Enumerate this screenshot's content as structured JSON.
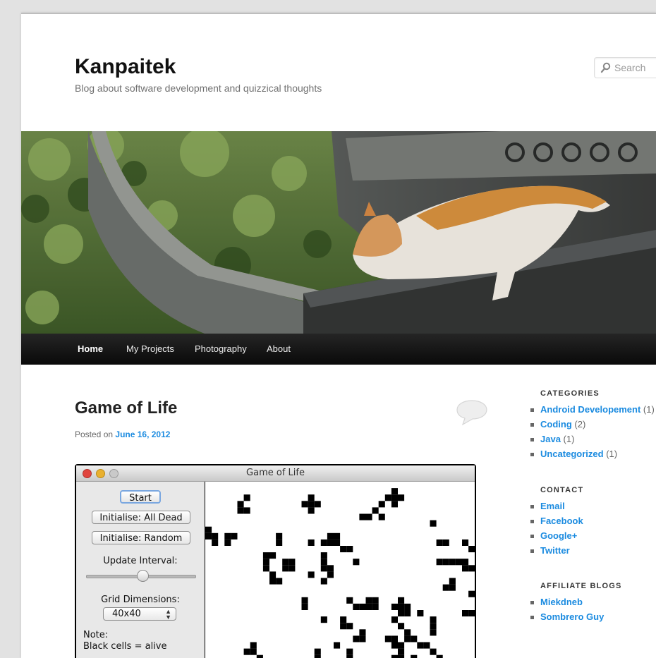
{
  "site": {
    "title": "Kanpaitek",
    "description": "Blog about software development and quizzical thoughts"
  },
  "search": {
    "placeholder": "Search",
    "icon": "search-icon"
  },
  "nav": {
    "items": [
      "Home",
      "My Projects",
      "Photography",
      "About"
    ],
    "current": "Home"
  },
  "post": {
    "title": "Game of Life",
    "posted_prefix": "Posted on",
    "date": "June 16, 2012",
    "comment_icon": "comment-bubble-icon"
  },
  "app_window": {
    "title": "Game of Life",
    "buttons": {
      "start": "Start",
      "init_dead": "Initialise: All Dead",
      "init_random": "Initialise: Random"
    },
    "update_interval_label": "Update Interval:",
    "update_interval_value": 0.52,
    "grid_dimensions_label": "Grid Dimensions:",
    "grid_dimensions_value": "40x40",
    "note_title": "Note:",
    "note_line1": "Black cells = alive",
    "grid_rows": [
      "..........................................",
      ".............................#............",
      "......#.........#...........###...........",
      ".....#.........###.........#.#............",
      ".....##.........#.........#...............",
      "........................##.#..............",
      "...................................#......",
      "#.........................................",
      "##.##......#.......##.....................",
      ".#.#.......#....#.###...............##..#..",
      ".....................##..................#.",
      ".........##.......#.......................",
      ".........#..##....#....#............#####.",
      ".........#..##....##....................##",
      "..........#.....#..#......................",
      "..........##......#...................#...",
      ".....................................##...",
      ".........................................#",
      "...............#......#..##...#...........",
      "...............#.......####..###..........",
      "..............................##.#......##",
      "..................#..#.......#.....#......",
      ".....................##.......#....#......",
      "........................#......#...#......",
      ".......................##...##.##.........",
      ".......#............#........##..##.......",
      "......##.........#....#.......#....#......",
      "........#........#....#......##.#...#.....",
      "..........#....##.....#...........#......."
    ]
  },
  "sidebar": {
    "categories": {
      "title": "CATEGORIES",
      "items": [
        {
          "label": "Android Developement",
          "count": "(1)"
        },
        {
          "label": "Coding",
          "count": "(2)"
        },
        {
          "label": "Java",
          "count": "(1)"
        },
        {
          "label": "Uncategorized",
          "count": "(1)"
        }
      ]
    },
    "contact": {
      "title": "CONTACT",
      "items": [
        {
          "label": "Email"
        },
        {
          "label": "Facebook"
        },
        {
          "label": "Google+"
        },
        {
          "label": "Twitter"
        }
      ]
    },
    "affiliate": {
      "title": "AFFILIATE BLOGS",
      "items": [
        {
          "label": "Miekdneb"
        },
        {
          "label": "Sombrero Guy"
        }
      ]
    }
  }
}
